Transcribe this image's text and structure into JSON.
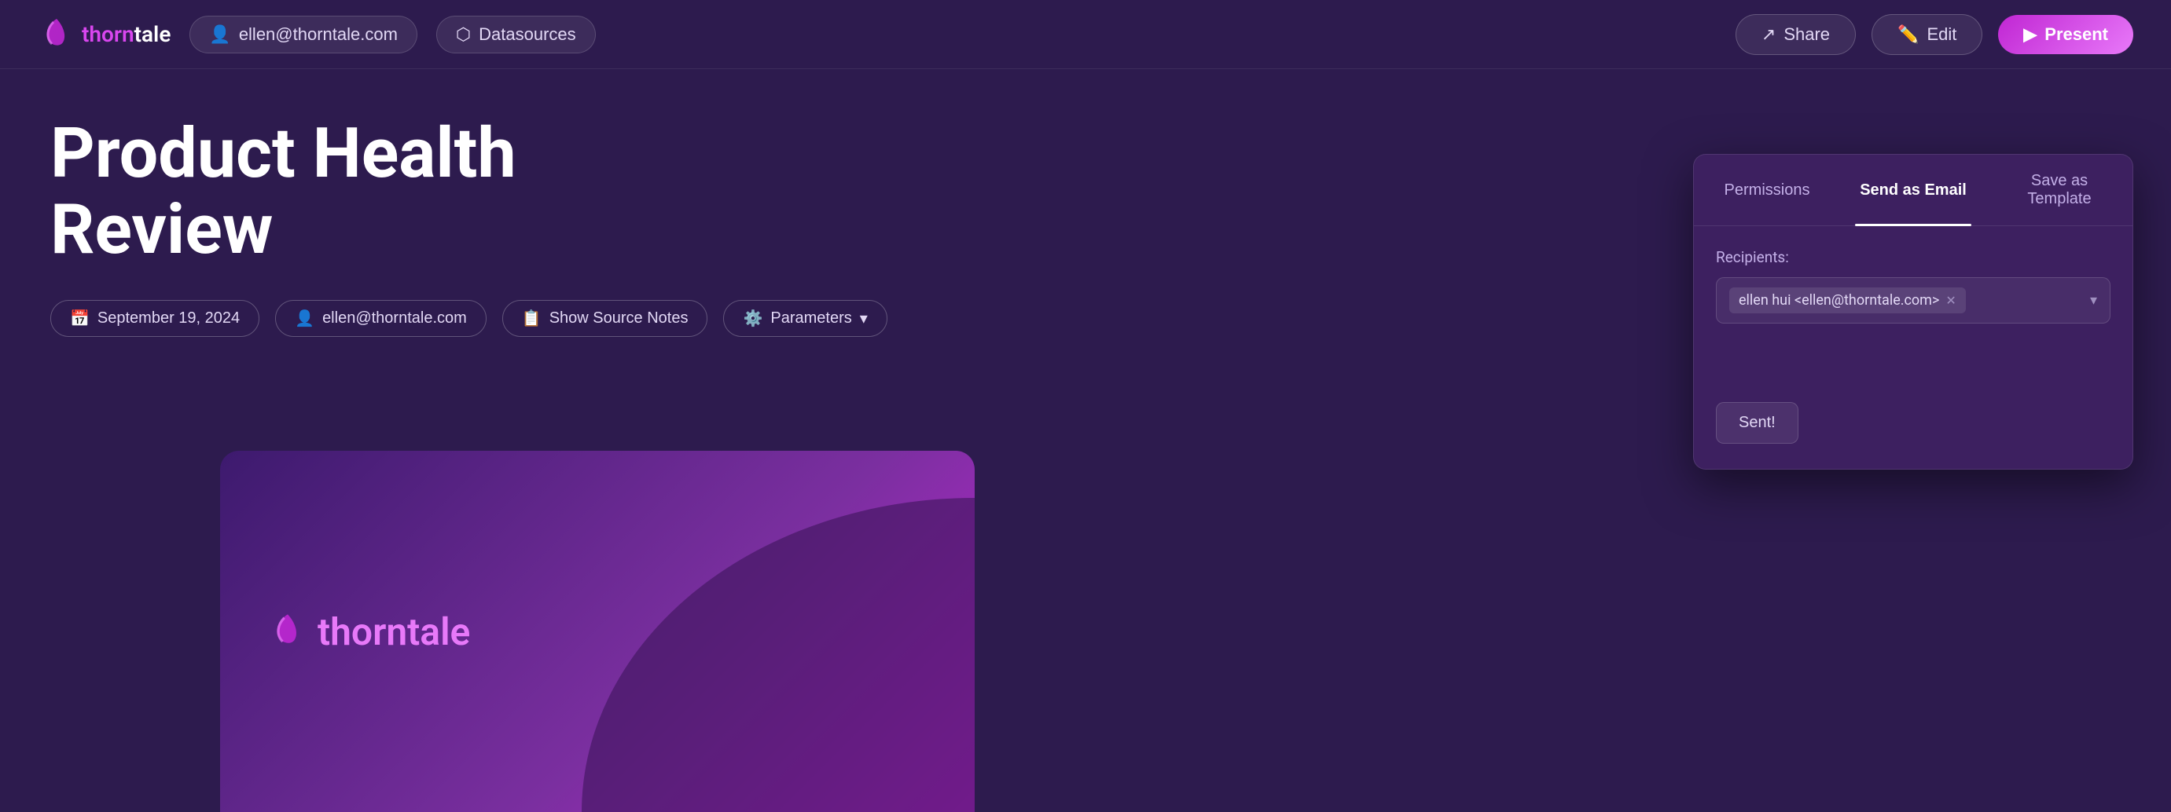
{
  "navbar": {
    "logo_thorn": "thorn",
    "logo_tale": "tale",
    "user_email": "ellen@thorntale.com",
    "datasources_label": "Datasources",
    "share_label": "Share",
    "edit_label": "Edit",
    "present_label": "Present"
  },
  "page": {
    "title": "Product Health Review",
    "date": "September 19, 2024",
    "author": "ellen@thorntale.com",
    "show_source_notes": "Show Source Notes",
    "parameters": "Parameters"
  },
  "slide": {
    "logo_thorn": "thorn",
    "logo_tale": "tale"
  },
  "share_panel": {
    "tab_permissions": "Permissions",
    "tab_send_email": "Send as Email",
    "tab_save_template": "Save as Template",
    "active_tab": "Send as Email",
    "recipients_label": "Recipients:",
    "recipient_value": "ellen hui <ellen@thorntale.com>",
    "sent_button": "Sent!"
  }
}
